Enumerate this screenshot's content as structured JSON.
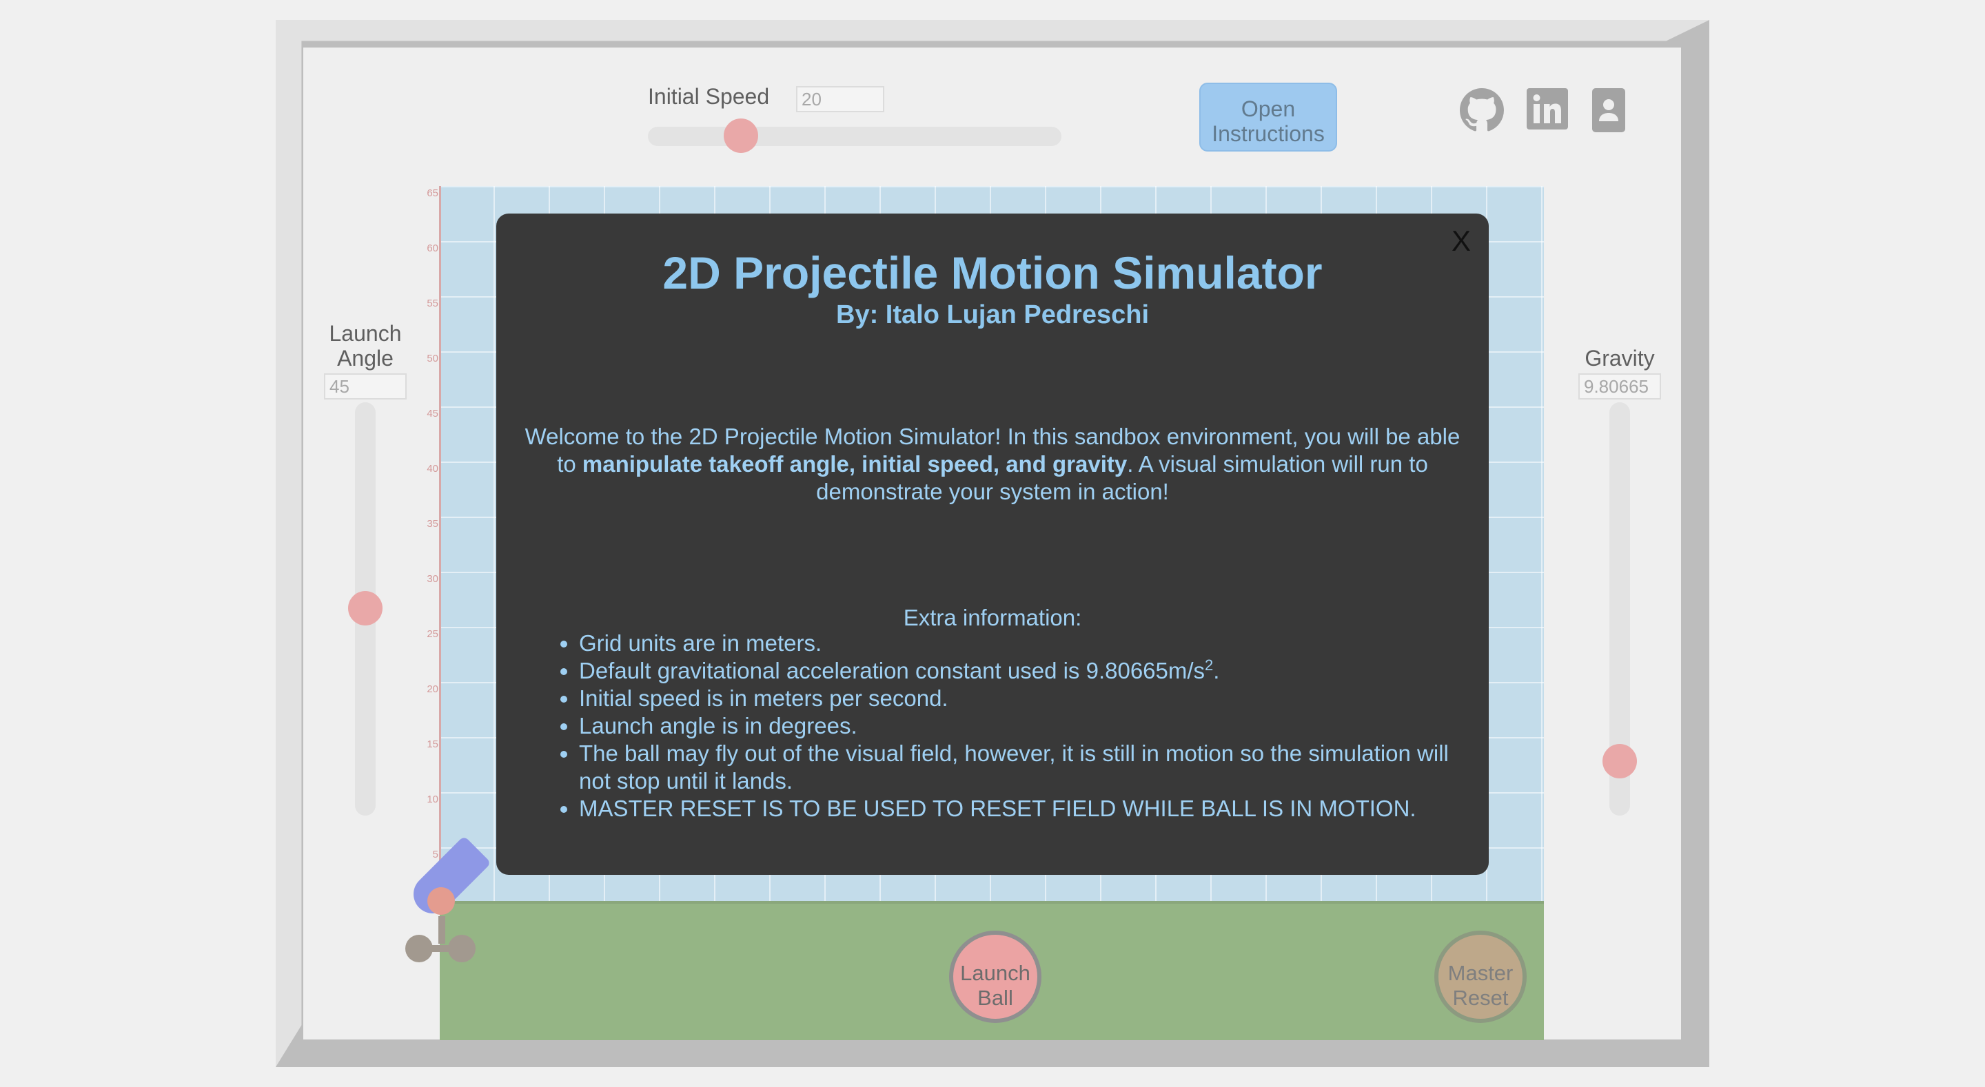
{
  "controls": {
    "initial_speed_label": "Initial Speed",
    "initial_speed_value": "20",
    "launch_angle_label_line1": "Launch",
    "launch_angle_label_line2": "Angle",
    "launch_angle_value": "45",
    "gravity_label": "Gravity",
    "gravity_value": "9.80665",
    "open_instructions_line1": "Open",
    "open_instructions_line2": "Instructions"
  },
  "social_icons": [
    "github-icon",
    "linkedin-icon",
    "profile-icon"
  ],
  "field": {
    "y_ticks": [
      "65",
      "60",
      "55",
      "50",
      "45",
      "40",
      "35",
      "30",
      "25",
      "20",
      "15",
      "10",
      "5"
    ]
  },
  "buttons": {
    "launch_line1": "Launch",
    "launch_line2": "Ball",
    "reset_line1": "Master",
    "reset_line2": "Reset"
  },
  "modal": {
    "close": "X",
    "title": "2D Projectile Motion Simulator",
    "subtitle": "By: Italo Lujan Pedreschi",
    "welcome_part1": "Welcome to the 2D Projectile Motion Simulator! In this sandbox environment, you will be able to ",
    "welcome_bold": "manipulate takeoff angle, initial speed, and gravity",
    "welcome_part2": ". A visual simulation will run to demonstrate your system in action!",
    "extra_heading": "Extra information:",
    "items": [
      "Grid units are in meters.",
      "Default gravitational acceleration constant used is 9.80665m/s",
      "Initial speed is in meters per second.",
      "Launch angle is in degrees.",
      "The ball may fly out of the visual field, however, it is still in motion so the simulation will not stop until it lands.",
      "MASTER RESET IS TO BE USED TO RESET FIELD WHILE BALL IS IN MOTION."
    ],
    "gravity_unit_exponent": "2",
    "gravity_unit_suffix": "."
  },
  "colors": {
    "sky": "#c3dcea",
    "ground": "#95b585",
    "modal_bg": "#393939",
    "modal_text": "#8ec7ee",
    "slider_thumb": "#e9a8a8",
    "cannon": "#8e98e6"
  }
}
